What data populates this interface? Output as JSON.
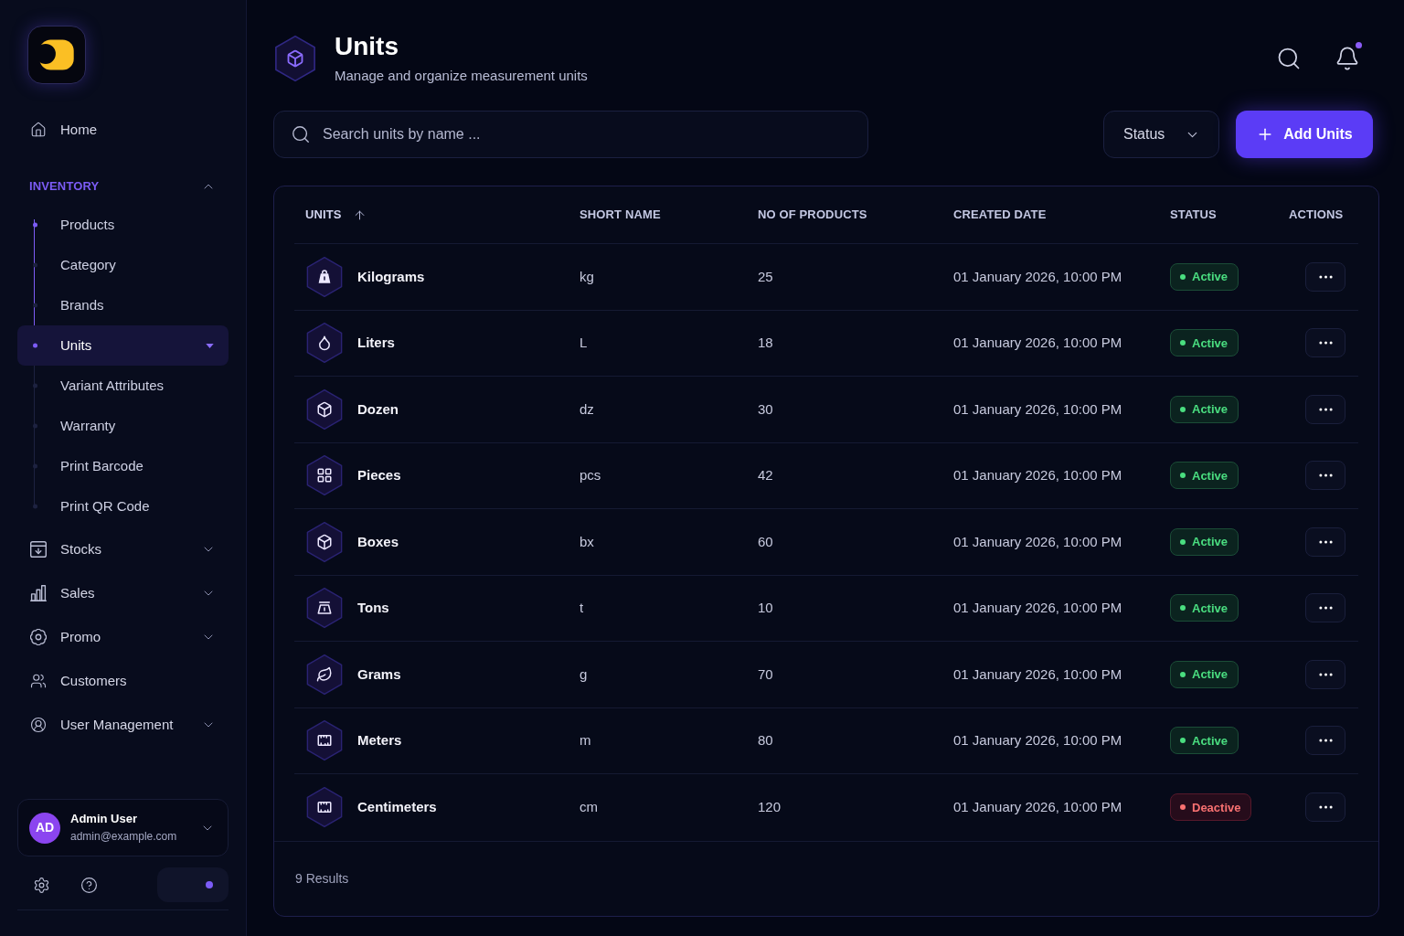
{
  "sidebar": {
    "items": [
      {
        "kind": "link",
        "label": "Home"
      },
      {
        "kind": "section",
        "label": "INVENTORY",
        "expanded": true,
        "children": [
          {
            "label": "Products",
            "selected": false
          },
          {
            "label": "Category",
            "selected": false
          },
          {
            "label": "Brands",
            "selected": false
          },
          {
            "label": "Units",
            "selected": true
          },
          {
            "label": "Variant Attributes",
            "selected": false
          },
          {
            "label": "Warranty",
            "selected": false
          },
          {
            "label": "Print Barcode",
            "selected": false
          },
          {
            "label": "Print QR Code",
            "selected": false
          }
        ]
      },
      {
        "kind": "group",
        "label": "Stocks",
        "expanded": false
      },
      {
        "kind": "group",
        "label": "Sales",
        "expanded": false
      },
      {
        "kind": "group",
        "label": "Promo",
        "expanded": false
      },
      {
        "kind": "link",
        "label": "Customers"
      },
      {
        "kind": "group",
        "label": "User Management",
        "expanded": false
      }
    ],
    "user": {
      "initials": "AD",
      "name": "Admin User",
      "email": "admin@example.com"
    },
    "theme_toggle": {
      "on": true
    }
  },
  "header": {
    "title": "Units",
    "subtitle": "Manage and organize measurement units",
    "notifications": {
      "unread": true
    }
  },
  "toolbar": {
    "search": {
      "placeholder": "Search units by name ..."
    },
    "status_filter": {
      "label": "Status"
    },
    "add_button": {
      "label": "Add Units"
    }
  },
  "table": {
    "columns": [
      {
        "label": "UNITS",
        "sorted": true
      },
      {
        "label": "SHORT NAME",
        "sorted": false
      },
      {
        "label": "NO OF PRODUCTS",
        "sorted": false
      },
      {
        "label": "CREATED DATE",
        "sorted": false
      },
      {
        "label": "STATUS",
        "sorted": false
      },
      {
        "label": "ACTIONS",
        "sorted": false
      }
    ],
    "rows": [
      {
        "name": "Kilograms",
        "short_name": "kg",
        "products": "25",
        "created": "01 January 2026, 10:00 PM",
        "status": {
          "label": "Active",
          "kind": "active"
        }
      },
      {
        "name": "Liters",
        "short_name": "L",
        "products": "18",
        "created": "01 January 2026, 10:00 PM",
        "status": {
          "label": "Active",
          "kind": "active"
        }
      },
      {
        "name": "Dozen",
        "short_name": "dz",
        "products": "30",
        "created": "01 January 2026, 10:00 PM",
        "status": {
          "label": "Active",
          "kind": "active"
        }
      },
      {
        "name": "Pieces",
        "short_name": "pcs",
        "products": "42",
        "created": "01 January 2026, 10:00 PM",
        "status": {
          "label": "Active",
          "kind": "active"
        }
      },
      {
        "name": "Boxes",
        "short_name": "bx",
        "products": "60",
        "created": "01 January 2026, 10:00 PM",
        "status": {
          "label": "Active",
          "kind": "active"
        }
      },
      {
        "name": "Tons",
        "short_name": "t",
        "products": "10",
        "created": "01 January 2026, 10:00 PM",
        "status": {
          "label": "Active",
          "kind": "active"
        }
      },
      {
        "name": "Grams",
        "short_name": "g",
        "products": "70",
        "created": "01 January 2026, 10:00 PM",
        "status": {
          "label": "Active",
          "kind": "active"
        }
      },
      {
        "name": "Meters",
        "short_name": "m",
        "products": "80",
        "created": "01 January 2026, 10:00 PM",
        "status": {
          "label": "Active",
          "kind": "active"
        }
      },
      {
        "name": "Centimeters",
        "short_name": "cm",
        "products": "120",
        "created": "01 January 2026, 10:00 PM",
        "status": {
          "label": "Deactive",
          "kind": "inactive"
        }
      }
    ],
    "footer": "9 Results"
  }
}
